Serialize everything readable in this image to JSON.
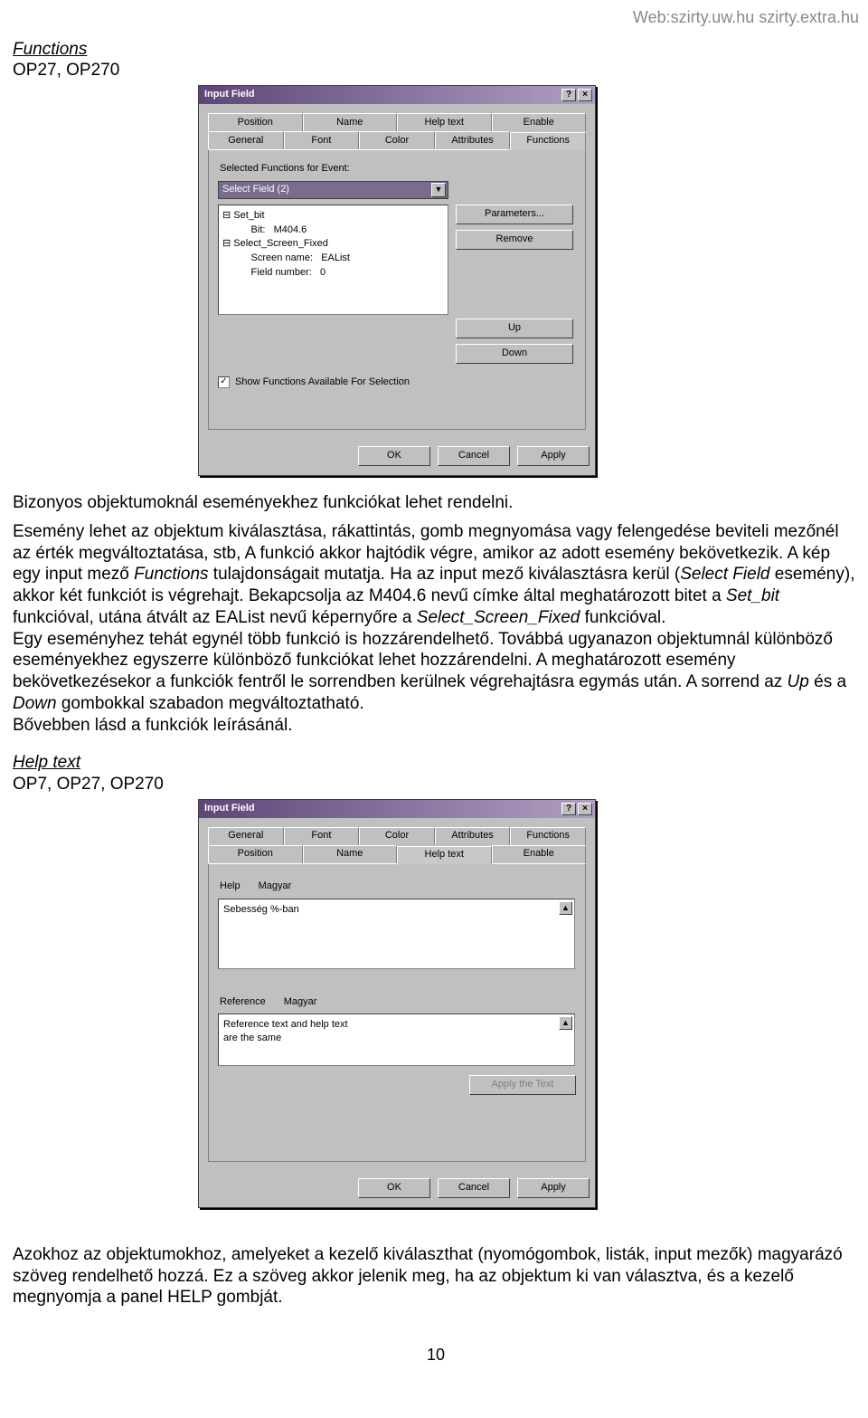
{
  "header_url": "Web:szirty.uw.hu  szirty.extra.hu",
  "page_number": "10",
  "section1": {
    "title": "Functions",
    "sub": "OP27, OP270"
  },
  "section2": {
    "title": "Help text",
    "sub": "OP7, OP27, OP270"
  },
  "intro_para": "Bizonyos objektumoknál eseményekhez funkciókat lehet rendelni.",
  "main_para": "Esemény lehet az objektum kiválasztása, rákattintás, gomb megnyomása vagy felengedése beviteli mezőnél az érték megváltoztatása, stb, A funkció akkor hajtódik végre, amikor az adott esemény bekövetkezik. A kép egy input mező Functions tulajdonságait mutatja. Ha az input mező kiválasztásra kerül (Select Field esemény), akkor két funkciót is végrehajt. Bekapcsolja az M404.6 nevű címke által meghatározott bitet a Set_bit funkcióval, utána átvált az EAList nevű képernyőre a Select_Screen_Fixed funkcióval.",
  "main_para2": "Egy eseményhez tehát egynél több funkció is hozzárendelhető. Továbbá ugyanazon objektumnál különböző eseményekhez egyszerre különböző funkciókat lehet hozzárendelni. A meghatározott esemény bekövetkezésekor a funkciók fentről le sorrendben kerülnek végrehajtásra egymás után. A sorrend az Up és a Down gombokkal szabadon megváltoztatható.",
  "main_para3": "Bővebben lásd a funkciók leírásánál.",
  "footer_para": "Azokhoz az objektumokhoz, amelyeket a kezelő kiválaszthat (nyomógombok, listák, input mezők) magyarázó szöveg rendelhető hozzá. Ez a szöveg akkor jelenik meg, ha az objektum ki van választva, és a kezelő megnyomja a panel HELP gombját.",
  "dialog1": {
    "title": "Input Field",
    "tabs_row1": [
      "Position",
      "Name",
      "Help text",
      "Enable"
    ],
    "tabs_row2": [
      "General",
      "Font",
      "Color",
      "Attributes",
      "Functions"
    ],
    "active_tab": "Functions",
    "label_selected": "Selected Functions for Event:",
    "combo_value": "Select Field  (2)",
    "tree": [
      "⊟ Set_bit",
      "      Bit:   M404.6",
      "⊟ Select_Screen_Fixed",
      "      Screen name:   EAList",
      "      Field number:   0"
    ],
    "btn_parameters": "Parameters...",
    "btn_remove": "Remove",
    "btn_up": "Up",
    "btn_down": "Down",
    "chk_label": "Show Functions Available For Selection",
    "chk_checked": true,
    "btn_ok": "OK",
    "btn_cancel": "Cancel",
    "btn_apply": "Apply"
  },
  "dialog2": {
    "title": "Input Field",
    "tabs_row1": [
      "General",
      "Font",
      "Color",
      "Attributes",
      "Functions"
    ],
    "tabs_row2": [
      "Position",
      "Name",
      "Help text",
      "Enable"
    ],
    "active_tab": "Help text",
    "kv_help": "Help",
    "kv_help_val": "Magyar",
    "help_text": "Sebesség %-ban",
    "kv_ref": "Reference",
    "kv_ref_val": "Magyar",
    "ref_text1": "Reference text and help text",
    "ref_text2": "are the same",
    "btn_apply_text": "Apply the Text",
    "btn_ok": "OK",
    "btn_cancel": "Cancel",
    "btn_apply": "Apply"
  }
}
